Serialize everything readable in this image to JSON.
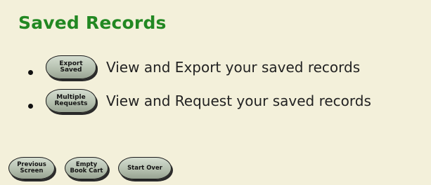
{
  "section": {
    "title": "Saved Records"
  },
  "items": [
    {
      "button_label": "Export\nSaved",
      "text": "View and Export your saved records"
    },
    {
      "button_label": "Multiple\nRequests",
      "text": "View and Request your saved records"
    }
  ],
  "footer": {
    "previous_label": "Previous\nScreen",
    "empty_label": "Empty\nBook Cart",
    "start_over_label": "Start Over"
  },
  "colors": {
    "panel_background": "#f3f0da",
    "title": "#228822",
    "button_fill": "#b6c1b0"
  }
}
